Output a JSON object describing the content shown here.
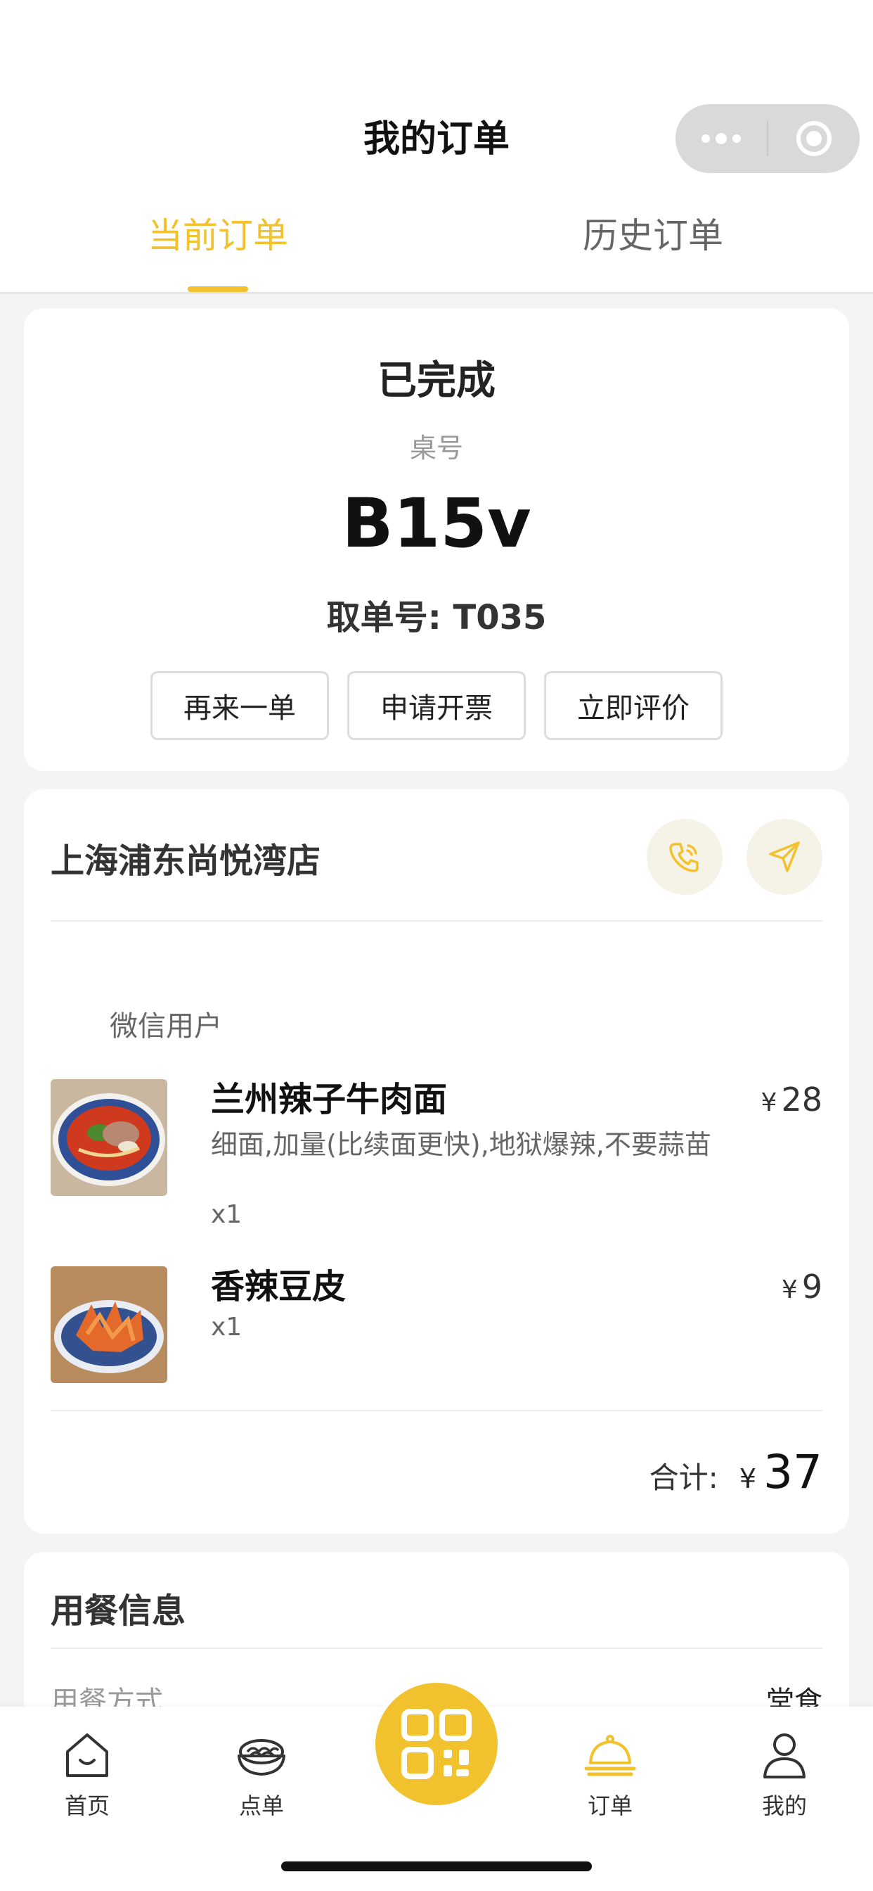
{
  "header": {
    "title": "我的订单",
    "tabs": [
      {
        "label": "当前订单",
        "active": true
      },
      {
        "label": "历史订单",
        "active": false
      }
    ]
  },
  "status_card": {
    "status": "已完成",
    "table_label": "桌号",
    "table_number": "B15v",
    "pickup_number": "取单号: T035",
    "buttons": {
      "reorder": "再来一单",
      "invoice": "申请开票",
      "review": "立即评价"
    }
  },
  "order_card": {
    "store_name": "上海浦东尚悦湾店",
    "icons": {
      "phone": "phone-icon",
      "navigate": "navigate-icon"
    },
    "user_name": "微信用户",
    "items": [
      {
        "name": "兰州辣子牛肉面",
        "spec": "细面,加量(比续面更快),地狱爆辣,不要蒜苗",
        "qty": "x1",
        "currency": "¥",
        "price": "28"
      },
      {
        "name": "香辣豆皮",
        "spec": "",
        "qty": "x1",
        "currency": "¥",
        "price": "9"
      }
    ],
    "total_label": "合计:",
    "total_currency": "¥",
    "total_value": "37"
  },
  "dining_card": {
    "title": "用餐信息",
    "method_label": "用餐方式",
    "method_value": "堂食"
  },
  "tabbar": {
    "items": [
      {
        "label": "首页",
        "icon": "home-icon"
      },
      {
        "label": "点单",
        "icon": "bowl-icon"
      },
      {
        "label": "订单",
        "icon": "cloche-icon",
        "active": true
      },
      {
        "label": "我的",
        "icon": "person-icon"
      }
    ],
    "scan_icon": "qr-code-icon"
  },
  "colors": {
    "accent": "#f2c12e",
    "text": "#222222",
    "muted": "#999999",
    "background": "#f4f4f4"
  }
}
